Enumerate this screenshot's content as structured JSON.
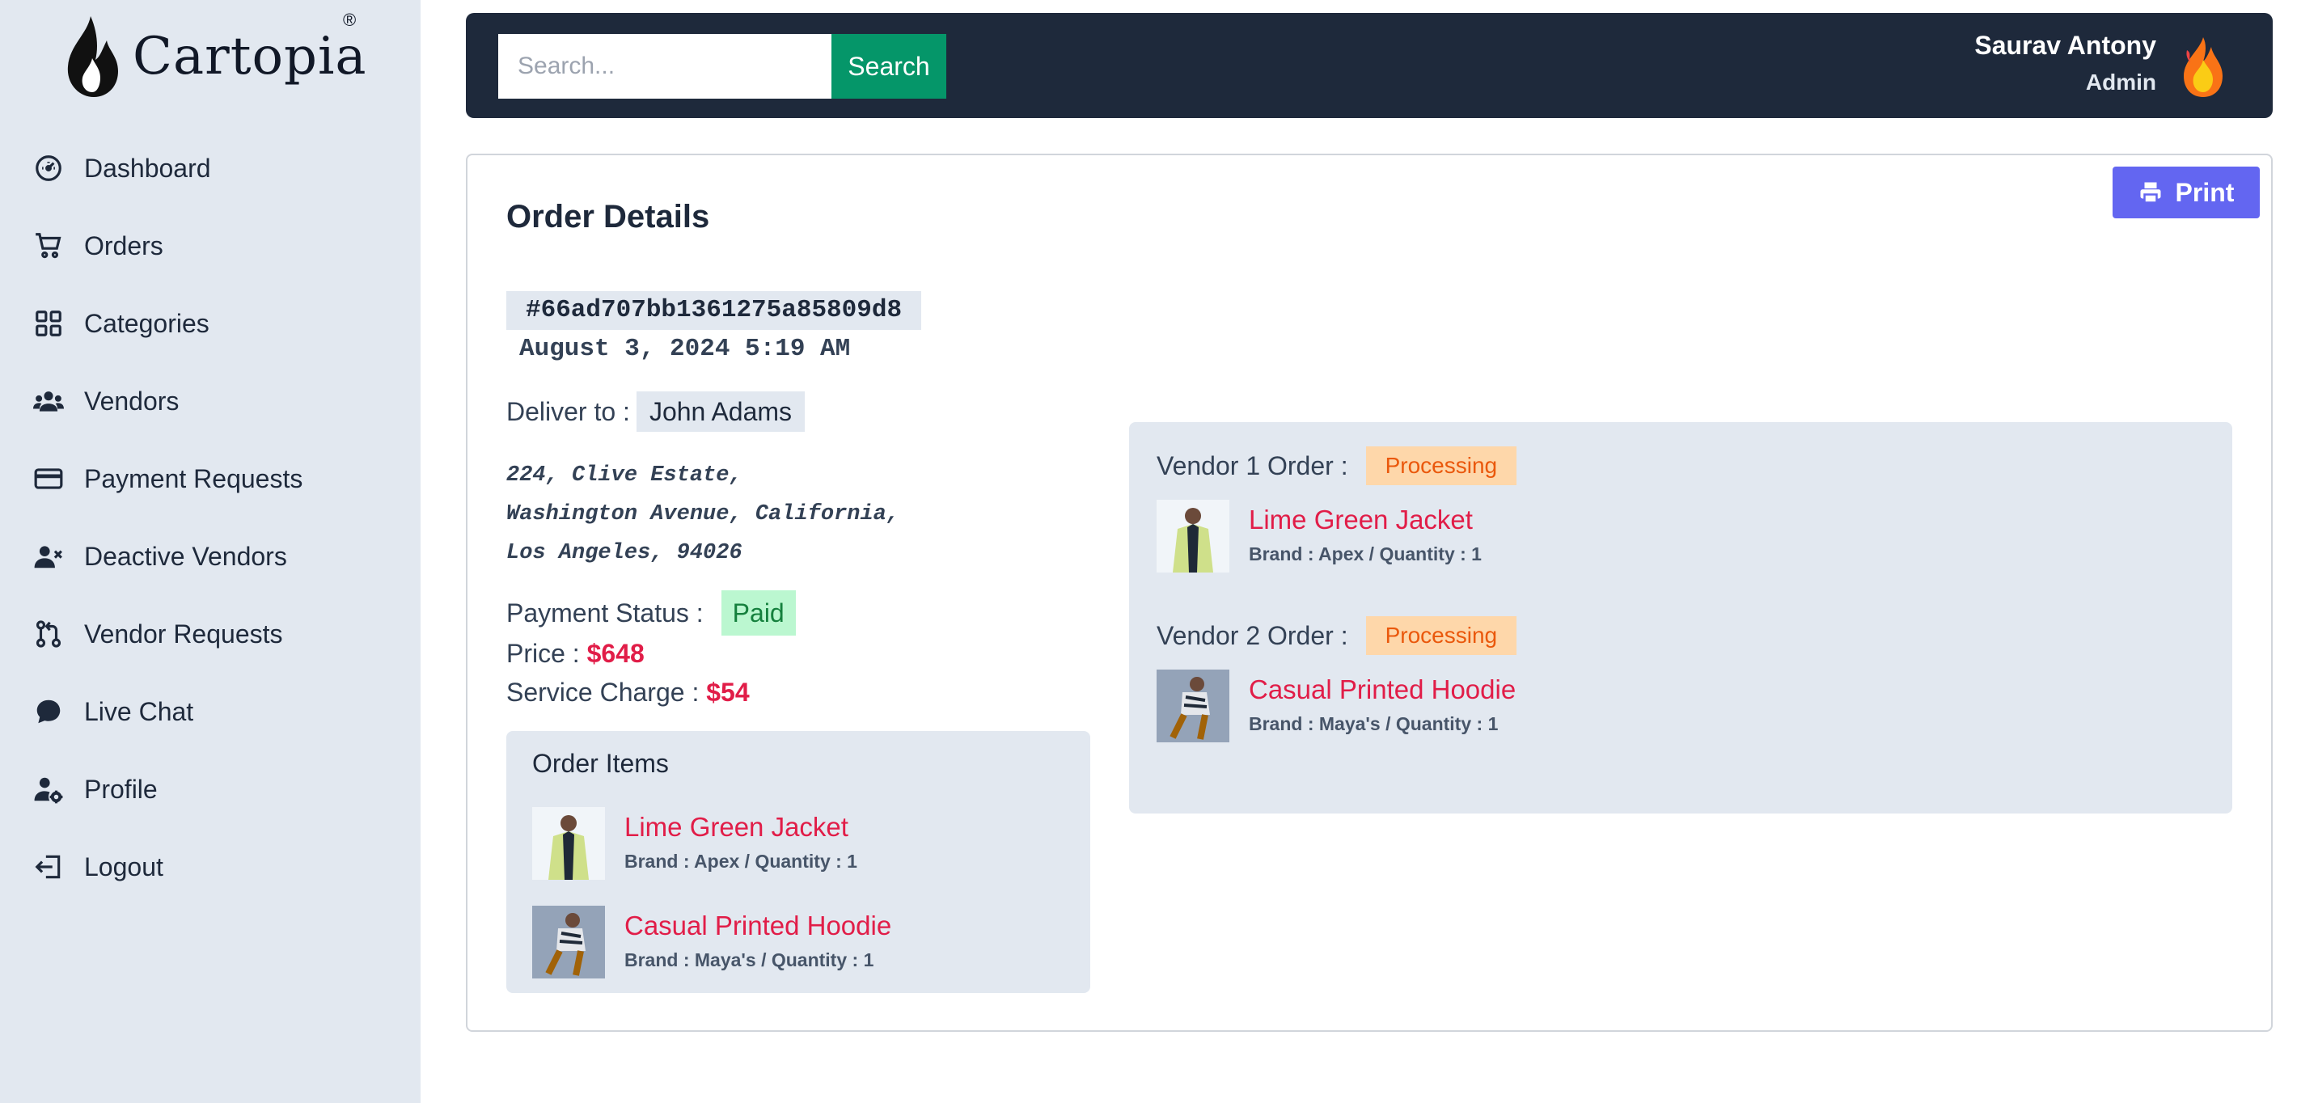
{
  "brand": {
    "name": "Cartopia",
    "reg": "®"
  },
  "sidebar": {
    "items": [
      {
        "label": "Dashboard",
        "icon": "gauge-icon"
      },
      {
        "label": "Orders",
        "icon": "cart-icon"
      },
      {
        "label": "Categories",
        "icon": "grid-icon"
      },
      {
        "label": "Vendors",
        "icon": "users-icon"
      },
      {
        "label": "Payment Requests",
        "icon": "credit-card-icon"
      },
      {
        "label": "Deactive Vendors",
        "icon": "user-x-icon"
      },
      {
        "label": "Vendor Requests",
        "icon": "git-pull-request-icon"
      },
      {
        "label": "Live Chat",
        "icon": "chat-icon"
      },
      {
        "label": "Profile",
        "icon": "user-gear-icon"
      },
      {
        "label": "Logout",
        "icon": "logout-icon"
      }
    ]
  },
  "header": {
    "search_placeholder": "Search...",
    "search_button": "Search",
    "user_name": "Saurav Antony",
    "user_role": "Admin"
  },
  "order": {
    "title": "Order Details",
    "print_label": "Print",
    "id": "#66ad707bb1361275a85809d8",
    "date": "August 3, 2024 5:19 AM",
    "deliver_label": "Deliver to :",
    "deliver_name": "John Adams",
    "address_lines": [
      "224, Clive Estate,",
      "Washington Avenue, California,",
      "Los Angeles, 94026"
    ],
    "payment_label": "Payment Status :",
    "payment_status": "Paid",
    "price_label": "Price :",
    "price": "$648",
    "service_label": "Service Charge :",
    "service_charge": "$54",
    "items_title": "Order Items",
    "items": [
      {
        "name": "Lime Green Jacket",
        "meta": "Brand : Apex / Quantity : 1"
      },
      {
        "name": "Casual Printed Hoodie",
        "meta": "Brand : Maya's / Quantity : 1"
      }
    ],
    "vendors": [
      {
        "label": "Vendor 1 Order :",
        "status": "Processing",
        "item": {
          "name": "Lime Green Jacket",
          "meta": "Brand : Apex / Quantity : 1"
        }
      },
      {
        "label": "Vendor 2 Order :",
        "status": "Processing",
        "item": {
          "name": "Casual Printed Hoodie",
          "meta": "Brand : Maya's / Quantity : 1"
        }
      }
    ]
  },
  "colors": {
    "sidebar_bg": "#e2e8f0",
    "header_bg": "#1e293b",
    "search_button": "#059669",
    "print_button": "#6366f1",
    "price_red": "#e11d48",
    "paid_green": "#bbf7d0",
    "processing_orange": "#fed7aa"
  }
}
